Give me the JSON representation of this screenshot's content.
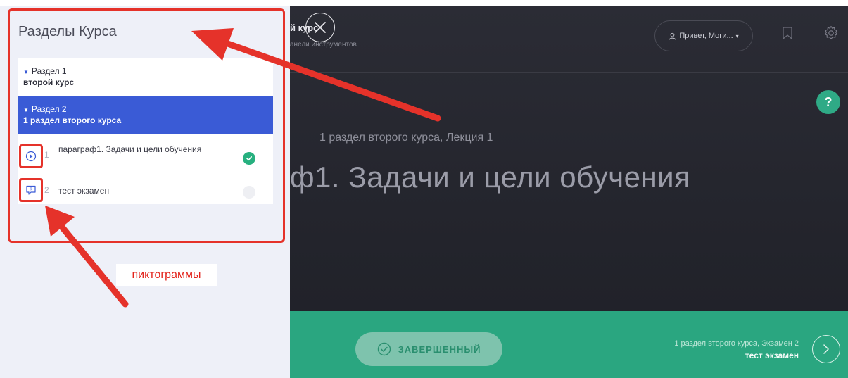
{
  "sidebar": {
    "title": "Разделы Курса",
    "sections": [
      {
        "head": "Раздел 1",
        "name": "второй курс"
      },
      {
        "head": "Раздел 2",
        "name": "1 раздел второго курса"
      }
    ],
    "lessons": [
      {
        "num": "1",
        "title": "параграф1. Задачи и цели обучения",
        "icon": "play-circle-icon",
        "status": "completed"
      },
      {
        "num": "2",
        "title": "тест экзамен",
        "icon": "quiz-icon",
        "status": "pending"
      }
    ]
  },
  "annotation": {
    "label": "пиктограммы"
  },
  "header": {
    "course_title": "й курс",
    "course_sub": "анели инструментов",
    "greeting": "Привет, Моги...",
    "greeting_caret": "▾"
  },
  "lecture": {
    "subtitle": "1 раздел второго курса, Лекция 1",
    "title": "ф1. Задачи и цели обучения"
  },
  "help": {
    "label": "?"
  },
  "footer": {
    "done_label": "ЗАВЕРШЕННЫЙ",
    "next_sub": "1 раздел второго курса, Экзамен 2",
    "next_title": "тест экзамен"
  },
  "colors": {
    "accent_blue": "#3a5bd6",
    "accent_green": "#2aa680",
    "annotation_red": "#e5322a"
  }
}
